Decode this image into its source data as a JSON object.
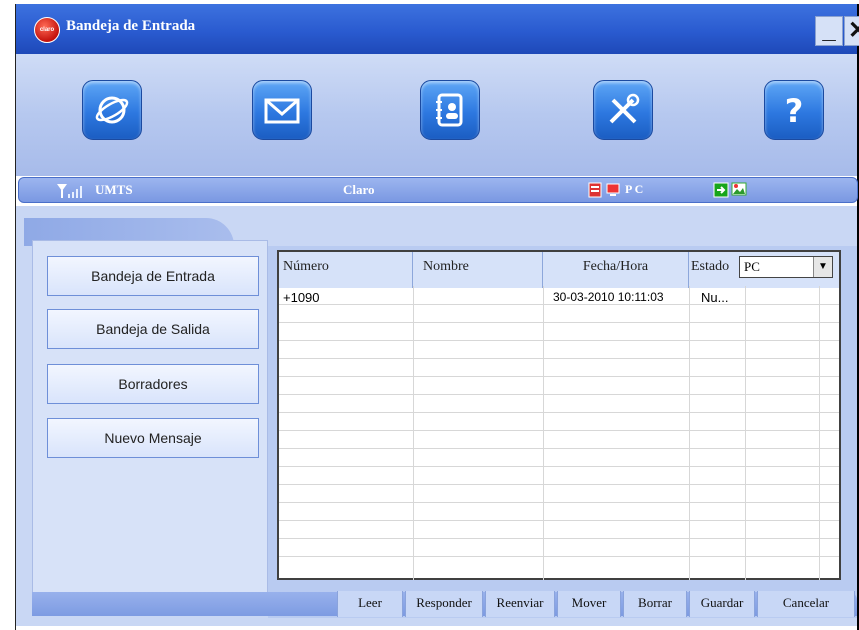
{
  "window": {
    "title": "Bandeja de Entrada",
    "logo_text": "claro",
    "minimize": "_",
    "close": "✕"
  },
  "toolbar": {
    "items": [
      {
        "icon": "internet-globe-icon"
      },
      {
        "icon": "mail-envelope-icon"
      },
      {
        "icon": "contacts-book-icon"
      },
      {
        "icon": "settings-tools-icon"
      },
      {
        "icon": "help-question-icon"
      }
    ]
  },
  "status": {
    "network": "UMTS",
    "operator": "Claro",
    "storage": "P C",
    "signal_icon": "signal-strength-icon"
  },
  "sidebar": {
    "items": [
      {
        "label": "Bandeja de Entrada"
      },
      {
        "label": "Bandeja de Salida"
      },
      {
        "label": "Borradores"
      },
      {
        "label": "Nuevo Mensaje"
      }
    ]
  },
  "messages": {
    "columns": [
      "Número",
      "Nombre",
      "Fecha/Hora",
      "Estado"
    ],
    "filter_value": "PC",
    "rows": [
      {
        "numero": "+1090",
        "nombre": "",
        "fecha": "30-03-2010 10:11:03",
        "estado": "Nu..."
      }
    ]
  },
  "actions": [
    "Leer",
    "Responder",
    "Reenviar",
    "Mover",
    "Borrar",
    "Guardar",
    "Cancelar"
  ],
  "colors": {
    "accent": "#2a5bd0",
    "panel": "#c9d7f4"
  }
}
